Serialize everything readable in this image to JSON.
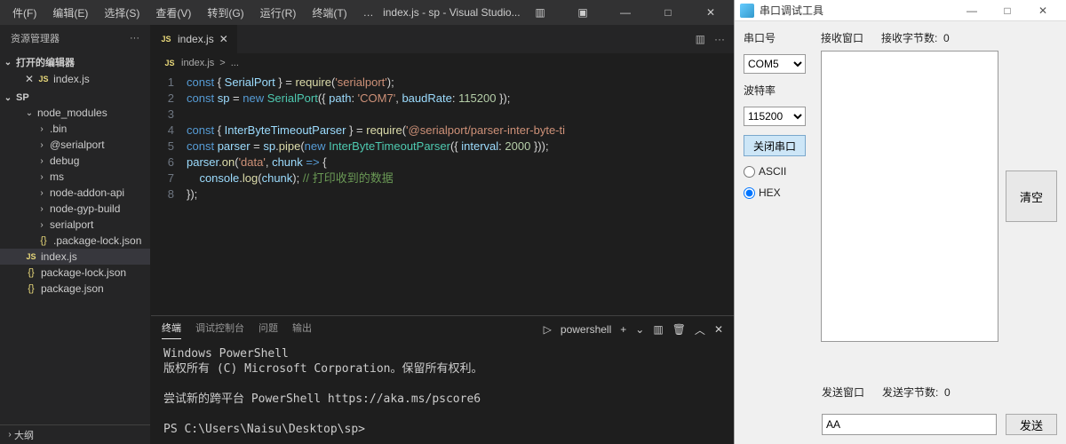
{
  "vscode": {
    "menu": [
      "件(F)",
      "编辑(E)",
      "选择(S)",
      "查看(V)",
      "转到(G)",
      "运行(R)",
      "终端(T)",
      "…"
    ],
    "title": "index.js - sp - Visual Studio...",
    "sidebar": {
      "title": "资源管理器",
      "open_editors": "打开的编辑器",
      "project": "SP",
      "items": [
        {
          "name": "node_modules",
          "type": "folder",
          "level": 1,
          "open": true
        },
        {
          "name": ".bin",
          "type": "folder",
          "level": 2
        },
        {
          "name": "@serialport",
          "type": "folder",
          "level": 2
        },
        {
          "name": "debug",
          "type": "folder",
          "level": 2
        },
        {
          "name": "ms",
          "type": "folder",
          "level": 2
        },
        {
          "name": "node-addon-api",
          "type": "folder",
          "level": 2
        },
        {
          "name": "node-gyp-build",
          "type": "folder",
          "level": 2
        },
        {
          "name": "serialport",
          "type": "folder",
          "level": 2
        },
        {
          "name": ".package-lock.json",
          "type": "json",
          "level": 2
        },
        {
          "name": "index.js",
          "type": "js",
          "level": 1,
          "selected": true
        },
        {
          "name": "package-lock.json",
          "type": "json",
          "level": 1
        },
        {
          "name": "package.json",
          "type": "json",
          "level": 1
        }
      ],
      "outline": "大纲",
      "open_file": "index.js"
    },
    "tab": {
      "label": "index.js"
    },
    "breadcrumb": [
      "index.js",
      ">",
      "..."
    ],
    "code": {
      "lines": [
        1,
        2,
        3,
        4,
        5,
        6,
        7,
        8
      ]
    },
    "terminal": {
      "tabs": [
        "终端",
        "调试控制台",
        "问题",
        "输出"
      ],
      "shell": "powershell",
      "lines": [
        "Windows PowerShell",
        "版权所有 (C) Microsoft Corporation。保留所有权利。",
        "",
        "尝试新的跨平台 PowerShell https://aka.ms/pscore6",
        "",
        "PS C:\\Users\\Naisu\\Desktop\\sp> "
      ]
    }
  },
  "serial": {
    "title": "串口调试工具",
    "port_label": "串口号",
    "port_value": "COM5",
    "baud_label": "波特率",
    "baud_value": "115200",
    "close_btn": "关闭串口",
    "ascii": "ASCII",
    "hex": "HEX",
    "recv_label": "接收窗口",
    "recv_bytes_label": "接收字节数:",
    "recv_bytes": "0",
    "clear_btn": "清空",
    "send_label": "发送窗口",
    "send_bytes_label": "发送字节数:",
    "send_bytes": "0",
    "send_value": "AA",
    "send_btn": "发送"
  }
}
